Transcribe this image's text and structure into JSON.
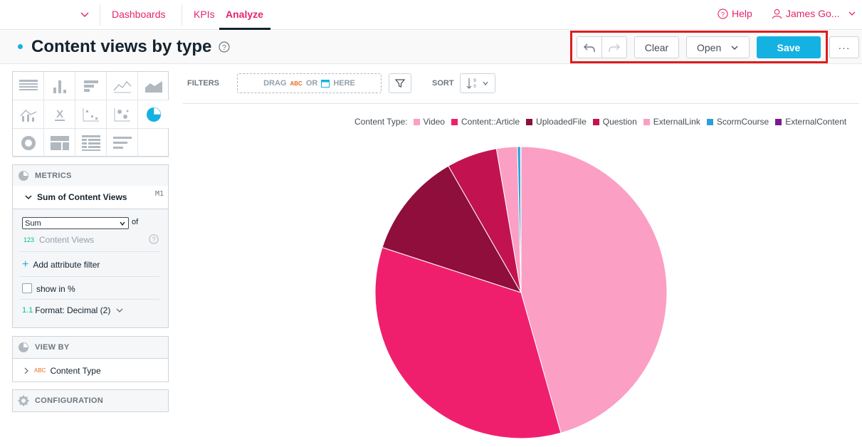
{
  "nav": {
    "dashboards": "Dashboards",
    "kpis": "KPIs",
    "analyze": "Analyze",
    "help": "Help",
    "user": "James Go..."
  },
  "title": "Content views by type",
  "toolbar": {
    "clear": "Clear",
    "open": "Open",
    "save": "Save",
    "more": "···"
  },
  "filters": {
    "label": "FILTERS",
    "drag_prefix": "DRAG",
    "drag_abc": "ABC",
    "drag_or": "OR",
    "drag_suffix": "HERE",
    "sort_label": "SORT"
  },
  "metrics": {
    "header": "METRICS",
    "item_title": "Sum of Content Views",
    "item_id": "M1",
    "aggregation": "Sum",
    "of_label": "of",
    "measure_prefix": "123",
    "measure_name": "Content Views",
    "add_filter": "Add attribute filter",
    "show_percent": "show in %",
    "format_prefix": "1.1",
    "format": "Format: Decimal (2)"
  },
  "view_by": {
    "header": "VIEW BY",
    "prefix": "ABC",
    "item": "Content Type"
  },
  "configuration": {
    "header": "CONFIGURATION"
  },
  "legend": {
    "title": "Content Type:"
  },
  "colors": {
    "accent": "#14b2e2",
    "brand": "#e5246e"
  },
  "chart_data": {
    "type": "pie",
    "categories": [
      "Video",
      "Content::Article",
      "UploadedFile",
      "Question",
      "ExternalLink",
      "ScormCourse",
      "ExternalContent"
    ],
    "values": [
      45.6,
      34.4,
      11.7,
      5.6,
      2.3,
      0.35,
      0.05
    ],
    "colors": [
      "#fb9fc4",
      "#f01f6e",
      "#8f0e3b",
      "#c21350",
      "#fb9fc4",
      "#2aa1db",
      "#7b1a8e"
    ],
    "legend_position": "top"
  }
}
